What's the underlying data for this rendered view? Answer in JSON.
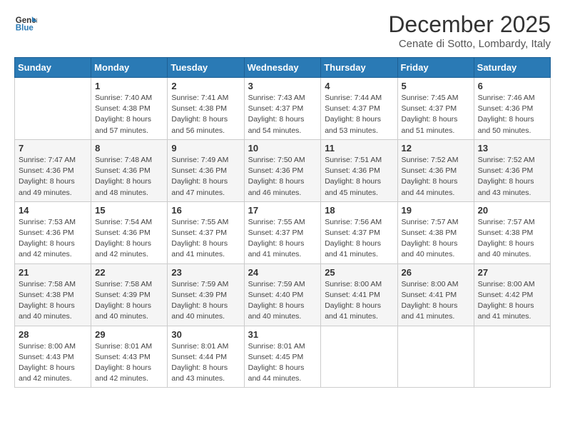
{
  "header": {
    "logo_line1": "General",
    "logo_line2": "Blue",
    "title": "December 2025",
    "subtitle": "Cenate di Sotto, Lombardy, Italy"
  },
  "days_of_week": [
    "Sunday",
    "Monday",
    "Tuesday",
    "Wednesday",
    "Thursday",
    "Friday",
    "Saturday"
  ],
  "weeks": [
    [
      {
        "day": "",
        "info": ""
      },
      {
        "day": "1",
        "info": "Sunrise: 7:40 AM\nSunset: 4:38 PM\nDaylight: 8 hours\nand 57 minutes."
      },
      {
        "day": "2",
        "info": "Sunrise: 7:41 AM\nSunset: 4:38 PM\nDaylight: 8 hours\nand 56 minutes."
      },
      {
        "day": "3",
        "info": "Sunrise: 7:43 AM\nSunset: 4:37 PM\nDaylight: 8 hours\nand 54 minutes."
      },
      {
        "day": "4",
        "info": "Sunrise: 7:44 AM\nSunset: 4:37 PM\nDaylight: 8 hours\nand 53 minutes."
      },
      {
        "day": "5",
        "info": "Sunrise: 7:45 AM\nSunset: 4:37 PM\nDaylight: 8 hours\nand 51 minutes."
      },
      {
        "day": "6",
        "info": "Sunrise: 7:46 AM\nSunset: 4:36 PM\nDaylight: 8 hours\nand 50 minutes."
      }
    ],
    [
      {
        "day": "7",
        "info": "Sunrise: 7:47 AM\nSunset: 4:36 PM\nDaylight: 8 hours\nand 49 minutes."
      },
      {
        "day": "8",
        "info": "Sunrise: 7:48 AM\nSunset: 4:36 PM\nDaylight: 8 hours\nand 48 minutes."
      },
      {
        "day": "9",
        "info": "Sunrise: 7:49 AM\nSunset: 4:36 PM\nDaylight: 8 hours\nand 47 minutes."
      },
      {
        "day": "10",
        "info": "Sunrise: 7:50 AM\nSunset: 4:36 PM\nDaylight: 8 hours\nand 46 minutes."
      },
      {
        "day": "11",
        "info": "Sunrise: 7:51 AM\nSunset: 4:36 PM\nDaylight: 8 hours\nand 45 minutes."
      },
      {
        "day": "12",
        "info": "Sunrise: 7:52 AM\nSunset: 4:36 PM\nDaylight: 8 hours\nand 44 minutes."
      },
      {
        "day": "13",
        "info": "Sunrise: 7:52 AM\nSunset: 4:36 PM\nDaylight: 8 hours\nand 43 minutes."
      }
    ],
    [
      {
        "day": "14",
        "info": "Sunrise: 7:53 AM\nSunset: 4:36 PM\nDaylight: 8 hours\nand 42 minutes."
      },
      {
        "day": "15",
        "info": "Sunrise: 7:54 AM\nSunset: 4:36 PM\nDaylight: 8 hours\nand 42 minutes."
      },
      {
        "day": "16",
        "info": "Sunrise: 7:55 AM\nSunset: 4:37 PM\nDaylight: 8 hours\nand 41 minutes."
      },
      {
        "day": "17",
        "info": "Sunrise: 7:55 AM\nSunset: 4:37 PM\nDaylight: 8 hours\nand 41 minutes."
      },
      {
        "day": "18",
        "info": "Sunrise: 7:56 AM\nSunset: 4:37 PM\nDaylight: 8 hours\nand 41 minutes."
      },
      {
        "day": "19",
        "info": "Sunrise: 7:57 AM\nSunset: 4:38 PM\nDaylight: 8 hours\nand 40 minutes."
      },
      {
        "day": "20",
        "info": "Sunrise: 7:57 AM\nSunset: 4:38 PM\nDaylight: 8 hours\nand 40 minutes."
      }
    ],
    [
      {
        "day": "21",
        "info": "Sunrise: 7:58 AM\nSunset: 4:38 PM\nDaylight: 8 hours\nand 40 minutes."
      },
      {
        "day": "22",
        "info": "Sunrise: 7:58 AM\nSunset: 4:39 PM\nDaylight: 8 hours\nand 40 minutes."
      },
      {
        "day": "23",
        "info": "Sunrise: 7:59 AM\nSunset: 4:39 PM\nDaylight: 8 hours\nand 40 minutes."
      },
      {
        "day": "24",
        "info": "Sunrise: 7:59 AM\nSunset: 4:40 PM\nDaylight: 8 hours\nand 40 minutes."
      },
      {
        "day": "25",
        "info": "Sunrise: 8:00 AM\nSunset: 4:41 PM\nDaylight: 8 hours\nand 41 minutes."
      },
      {
        "day": "26",
        "info": "Sunrise: 8:00 AM\nSunset: 4:41 PM\nDaylight: 8 hours\nand 41 minutes."
      },
      {
        "day": "27",
        "info": "Sunrise: 8:00 AM\nSunset: 4:42 PM\nDaylight: 8 hours\nand 41 minutes."
      }
    ],
    [
      {
        "day": "28",
        "info": "Sunrise: 8:00 AM\nSunset: 4:43 PM\nDaylight: 8 hours\nand 42 minutes."
      },
      {
        "day": "29",
        "info": "Sunrise: 8:01 AM\nSunset: 4:43 PM\nDaylight: 8 hours\nand 42 minutes."
      },
      {
        "day": "30",
        "info": "Sunrise: 8:01 AM\nSunset: 4:44 PM\nDaylight: 8 hours\nand 43 minutes."
      },
      {
        "day": "31",
        "info": "Sunrise: 8:01 AM\nSunset: 4:45 PM\nDaylight: 8 hours\nand 44 minutes."
      },
      {
        "day": "",
        "info": ""
      },
      {
        "day": "",
        "info": ""
      },
      {
        "day": "",
        "info": ""
      }
    ]
  ]
}
